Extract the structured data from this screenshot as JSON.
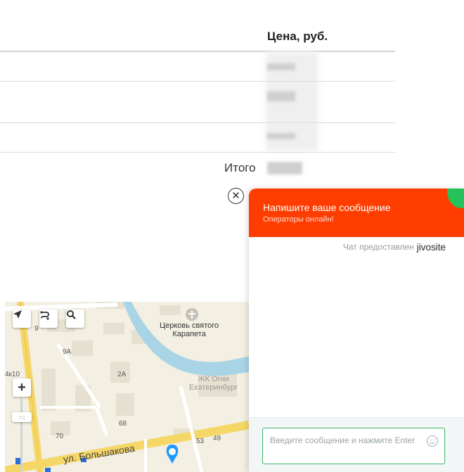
{
  "table": {
    "price_header": "Цена, руб.",
    "total_label": "Итого",
    "remove_symbol": "✕"
  },
  "map": {
    "labels": {
      "church": "Церковь святого\nКарапета",
      "complex": "ЖК Огни\nЕкатеринбург",
      "street": "ул. Большакова",
      "n9": "9",
      "n9a": "9А",
      "n2a": "2А",
      "n4k10": "4к10",
      "n68": "68",
      "n70": "70",
      "n53": "53",
      "n49": "49"
    },
    "controls": {
      "zoom_in": "+",
      "slider": "::::"
    },
    "colors": {
      "river": "#a8d4e6",
      "road": "#ffffff",
      "main_road": "#f5d768",
      "building": "#e6e0d0",
      "marker": "#1e98ff"
    }
  },
  "chat": {
    "title": "Напишите ваше сообщение",
    "subtitle": "Операторы онлайн!",
    "powered_by": "Чат предоставлен",
    "brand": "jivosite",
    "input_placeholder": "Введите сообщение и нажмите Enter",
    "colors": {
      "header": "#ff3d00",
      "online": "#25c15a",
      "input_border": "#3bb36a"
    }
  }
}
